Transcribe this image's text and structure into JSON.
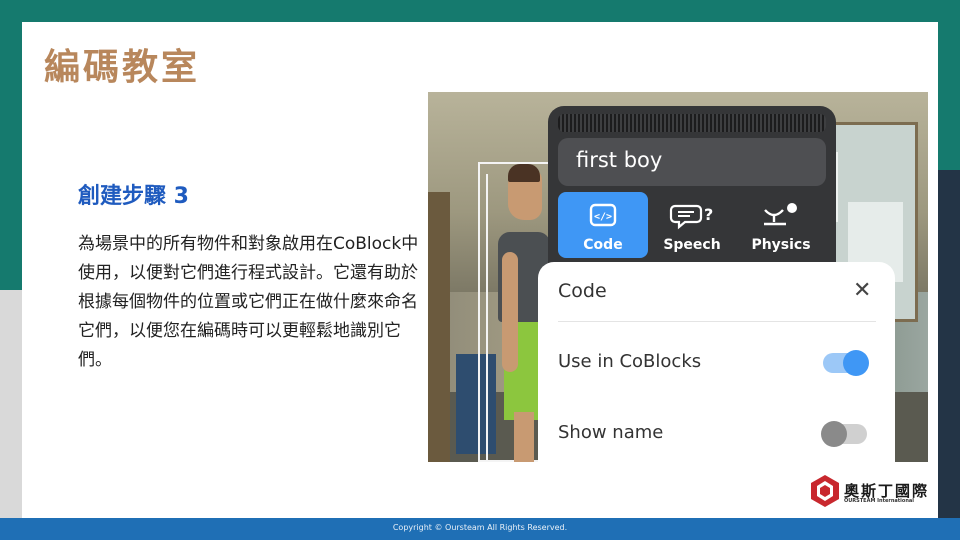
{
  "slide": {
    "title": "編碼教室",
    "step_heading": "創建步驟 3",
    "body": "為場景中的所有物件和對象啟用在CoBlock中使用，以便對它們進行程式設計。它還有助於根據每個物件的位置或它們正在做什麼來命名它們，以便您在編碼時可以更輕鬆地識別它們。"
  },
  "inspector": {
    "object_name": "first boy",
    "tabs": [
      {
        "label": "Code",
        "icon": "code-icon",
        "active": true
      },
      {
        "label": "Speech",
        "icon": "speech-bubble-icon",
        "active": false
      },
      {
        "label": "Physics",
        "icon": "physics-icon",
        "active": false
      }
    ],
    "sheet": {
      "title": "Code",
      "close_icon": "close-icon",
      "rows": [
        {
          "label": "Use in CoBlocks",
          "enabled": true
        },
        {
          "label": "Show name",
          "enabled": false
        }
      ]
    }
  },
  "logo": {
    "cn": "奧斯丁國際",
    "en": "OURSTEAM International"
  },
  "footer": {
    "text": "Copyright © Oursteam All Rights Reserved."
  },
  "colors": {
    "teal": "#157a6e",
    "navy": "#233446",
    "title_brown": "#b8875c",
    "heading_blue": "#1f5bbf",
    "footer_blue": "#1f6fb5",
    "active_tab_blue": "#3f97f5",
    "logo_red": "#c8282e"
  }
}
